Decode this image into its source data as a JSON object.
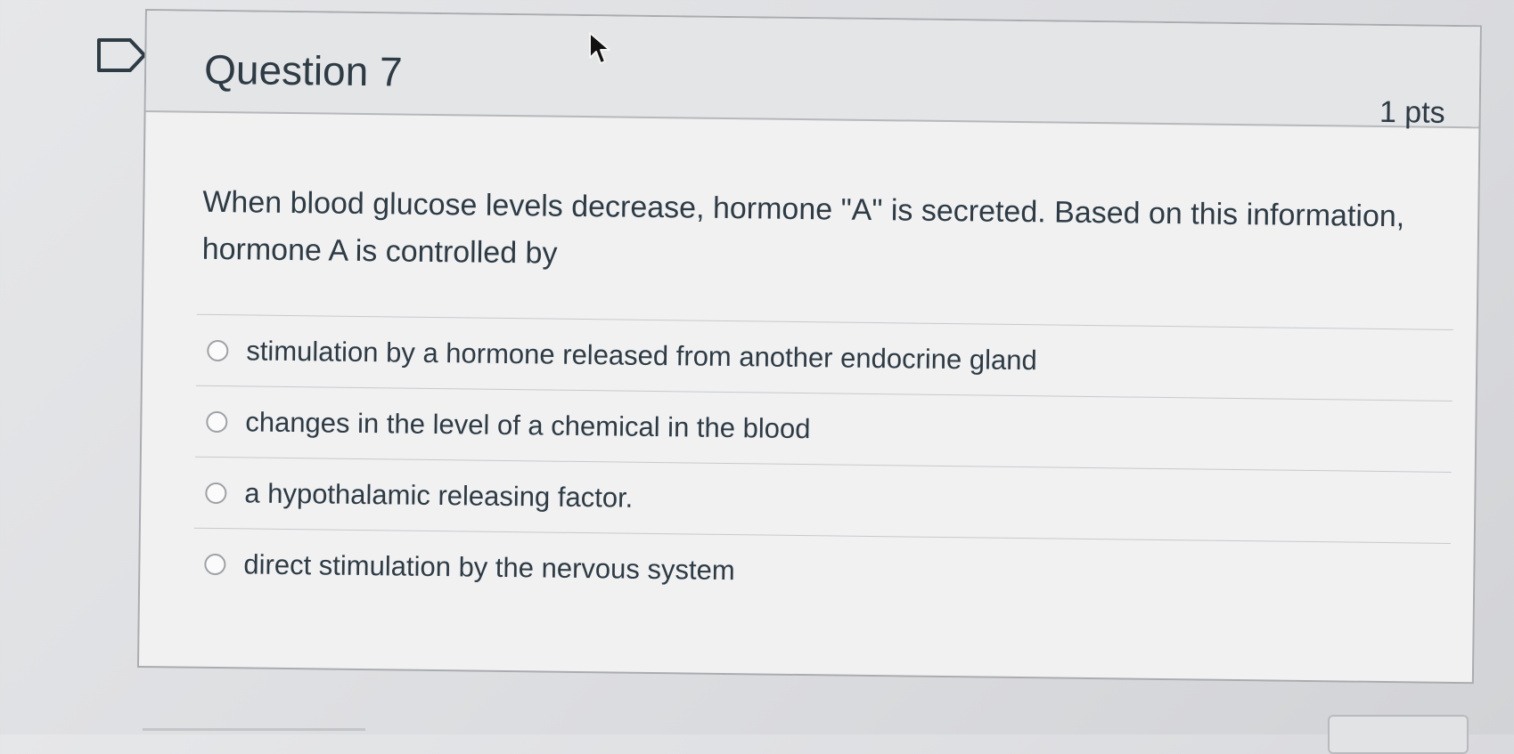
{
  "question": {
    "title": "Question 7",
    "points": "1 pts",
    "text": "When blood glucose levels decrease, hormone \"A\" is secreted. Based on this information, hormone A is controlled by",
    "answers": [
      {
        "label": "stimulation by a hormone released from another endocrine gland",
        "selected": false
      },
      {
        "label": "changes in the level of a chemical in the blood",
        "selected": false
      },
      {
        "label": "a hypothalamic releasing factor.",
        "selected": false
      },
      {
        "label": "direct stimulation by the nervous system",
        "selected": false
      }
    ]
  },
  "icons": {
    "flag": "flag-outline-icon",
    "cursor": "mouse-pointer-icon"
  },
  "colors": {
    "text": "#2d3b45",
    "header_bg": "#e4e5e7",
    "card_bg": "#f1f1f2",
    "border": "#a9abaf"
  }
}
